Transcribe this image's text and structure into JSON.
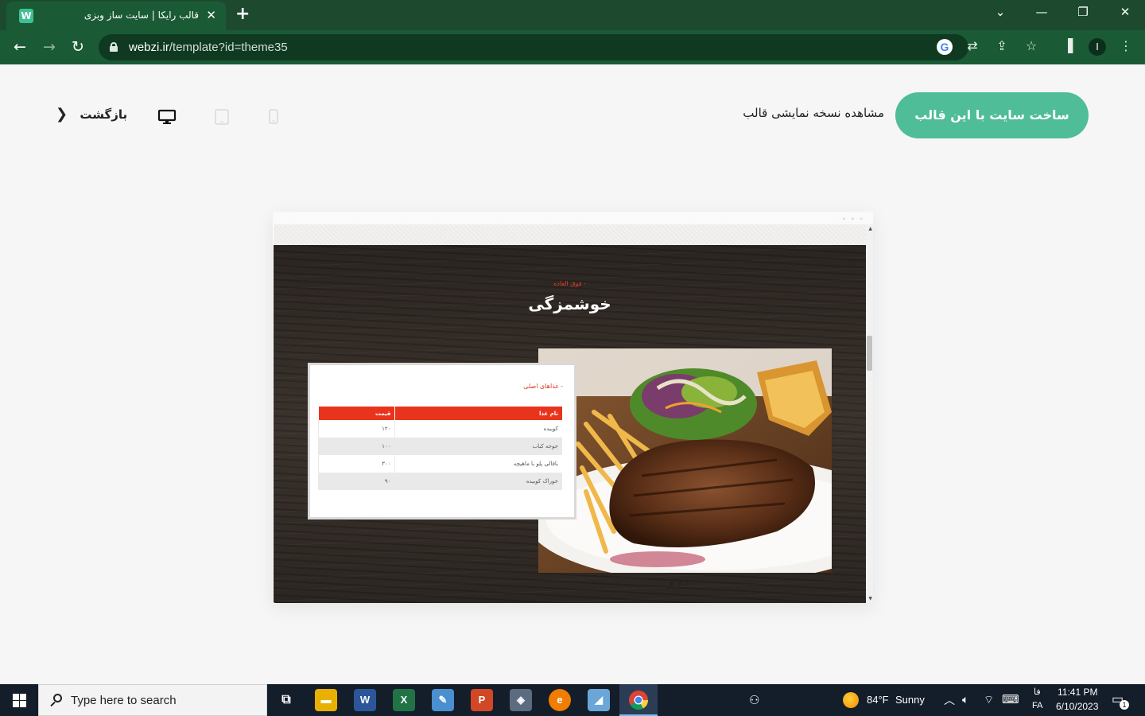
{
  "browser": {
    "tab_title": "قالب رایکا | سایت ساز وبزی",
    "url_host": "webzi.ir",
    "url_path": "/template?id=theme35",
    "profile_initial": "I"
  },
  "page": {
    "cta_button": "ساخت سایت با این قالب",
    "demo_label": "مشاهده نسخه نمایشی قالب",
    "back_label": "بازگشت"
  },
  "preview": {
    "hero_kicker": "- فوق العاده",
    "hero_title": "خوشمزگی",
    "menu_heading": "- غذاهای اصلی",
    "table_headers": {
      "name": "نام غذا",
      "price": "قیمت"
    },
    "rows": [
      {
        "name": "کوبیده",
        "price": "۱۲۰"
      },
      {
        "name": "جوجه کباب",
        "price": "۱۰۰"
      },
      {
        "name": "باقالی پلو با ماهیچه",
        "price": "۳۰۰"
      },
      {
        "name": "خوراک کوبیده",
        "price": "۹۰"
      }
    ]
  },
  "taskbar": {
    "search_placeholder": "Type here to search",
    "weather_temp": "84°F",
    "weather_text": "Sunny",
    "lang_top": "فا",
    "lang_bottom": "FA",
    "time": "11:41 PM",
    "date": "6/10/2023",
    "notification_count": "1"
  },
  "colors": {
    "chrome": "#1a5b36",
    "cta": "#4fbd98",
    "accent_red": "#e8341c"
  },
  "icons": {
    "tab_favicon": "webzi-logo-icon",
    "nav": [
      "back-arrow-icon",
      "forward-arrow-icon",
      "reload-icon",
      "lock-icon"
    ],
    "toolbar": [
      "google-icon",
      "translate-icon",
      "share-icon",
      "star-icon",
      "sidebar-icon",
      "kebab-menu-icon"
    ],
    "devices": [
      "desktop-icon",
      "tablet-icon",
      "mobile-icon"
    ]
  }
}
